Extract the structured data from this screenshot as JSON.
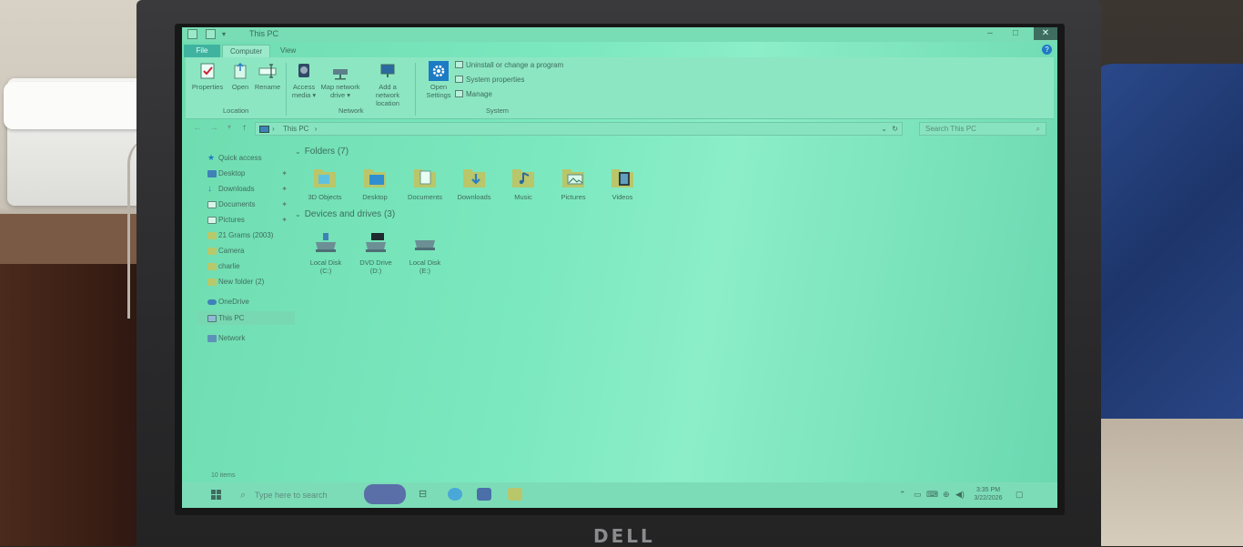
{
  "window": {
    "title": "This PC",
    "controls": {
      "minimize": "–",
      "maximize": "□",
      "close": "✕"
    },
    "help": "?"
  },
  "ribbon": {
    "tabs": [
      "File",
      "Computer",
      "View"
    ],
    "groups": {
      "location": {
        "label": "Location",
        "buttons": [
          "Properties",
          "Open",
          "Rename"
        ]
      },
      "network": {
        "label": "Network",
        "buttons": [
          "Access media ▾",
          "Map network drive ▾",
          "Add a network location"
        ]
      },
      "system": {
        "label": "System",
        "open_settings": "Open Settings",
        "items": [
          "Uninstall or change a program",
          "System properties",
          "Manage"
        ]
      }
    }
  },
  "address_bar": {
    "path": "This PC",
    "search_placeholder": "Search This PC"
  },
  "nav_pane": {
    "quick_access": "Quick access",
    "items": [
      {
        "label": "Desktop",
        "pinned": true
      },
      {
        "label": "Downloads",
        "pinned": true
      },
      {
        "label": "Documents",
        "pinned": true
      },
      {
        "label": "Pictures",
        "pinned": true
      },
      {
        "label": "21 Grams (2003)",
        "pinned": false
      },
      {
        "label": "Camera",
        "pinned": false
      },
      {
        "label": "charlie",
        "pinned": false
      },
      {
        "label": "New folder (2)",
        "pinned": false
      }
    ],
    "onedrive": "OneDrive",
    "this_pc": "This PC",
    "network": "Network"
  },
  "content": {
    "folders_header": "Folders (7)",
    "folders": [
      "3D Objects",
      "Desktop",
      "Documents",
      "Downloads",
      "Music",
      "Pictures",
      "Videos"
    ],
    "devices_header": "Devices and drives (3)",
    "drives": [
      {
        "name": "Local Disk",
        "letter": "(C:)"
      },
      {
        "name": "DVD Drive",
        "letter": "(D:)"
      },
      {
        "name": "Local Disk",
        "letter": "(E:)"
      }
    ]
  },
  "status_bar": {
    "items_count": "10 items"
  },
  "taskbar": {
    "search_placeholder": "Type here to search",
    "time": "3:35 PM",
    "date": "3/22/2026"
  },
  "device": {
    "brand": "DELL"
  },
  "colors": {
    "screen_tint": "#7be8bf",
    "file_tab": "#3fb3a0",
    "close_button": "#3e6e5f"
  }
}
